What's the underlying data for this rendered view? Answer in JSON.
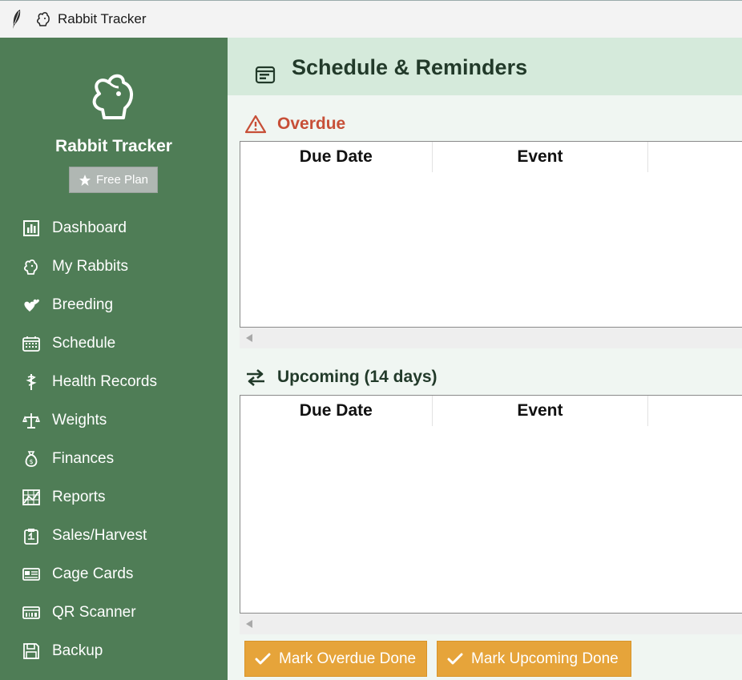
{
  "window": {
    "title": "Rabbit Tracker"
  },
  "sidebar": {
    "brand": "Rabbit Tracker",
    "plan": "Free Plan",
    "items": [
      {
        "label": "Dashboard",
        "icon": "bar-chart-icon"
      },
      {
        "label": "My Rabbits",
        "icon": "rabbit-icon"
      },
      {
        "label": "Breeding",
        "icon": "hearts-icon"
      },
      {
        "label": "Schedule",
        "icon": "calendar-icon"
      },
      {
        "label": "Health Records",
        "icon": "caduceus-icon"
      },
      {
        "label": "Weights",
        "icon": "scale-icon"
      },
      {
        "label": "Finances",
        "icon": "money-bag-icon"
      },
      {
        "label": "Reports",
        "icon": "chart-grid-icon"
      },
      {
        "label": "Sales/Harvest",
        "icon": "clipboard-icon"
      },
      {
        "label": "Cage Cards",
        "icon": "card-icon"
      },
      {
        "label": "QR Scanner",
        "icon": "scanner-icon"
      },
      {
        "label": "Backup",
        "icon": "floppy-icon"
      }
    ]
  },
  "main": {
    "title": "Schedule & Reminders",
    "overdue": {
      "title": "Overdue",
      "columns": [
        "Due Date",
        "Event",
        ""
      ]
    },
    "upcoming": {
      "title": "Upcoming (14 days)",
      "columns": [
        "Due Date",
        "Event",
        ""
      ]
    },
    "buttons": {
      "mark_overdue": "Mark Overdue Done",
      "mark_upcoming": "Mark Upcoming Done"
    }
  },
  "colors": {
    "sidebar_bg": "#4f7d56",
    "header_bg": "#d5eadb",
    "overdue_accent": "#c74f37",
    "button_bg": "#e6a43a"
  }
}
